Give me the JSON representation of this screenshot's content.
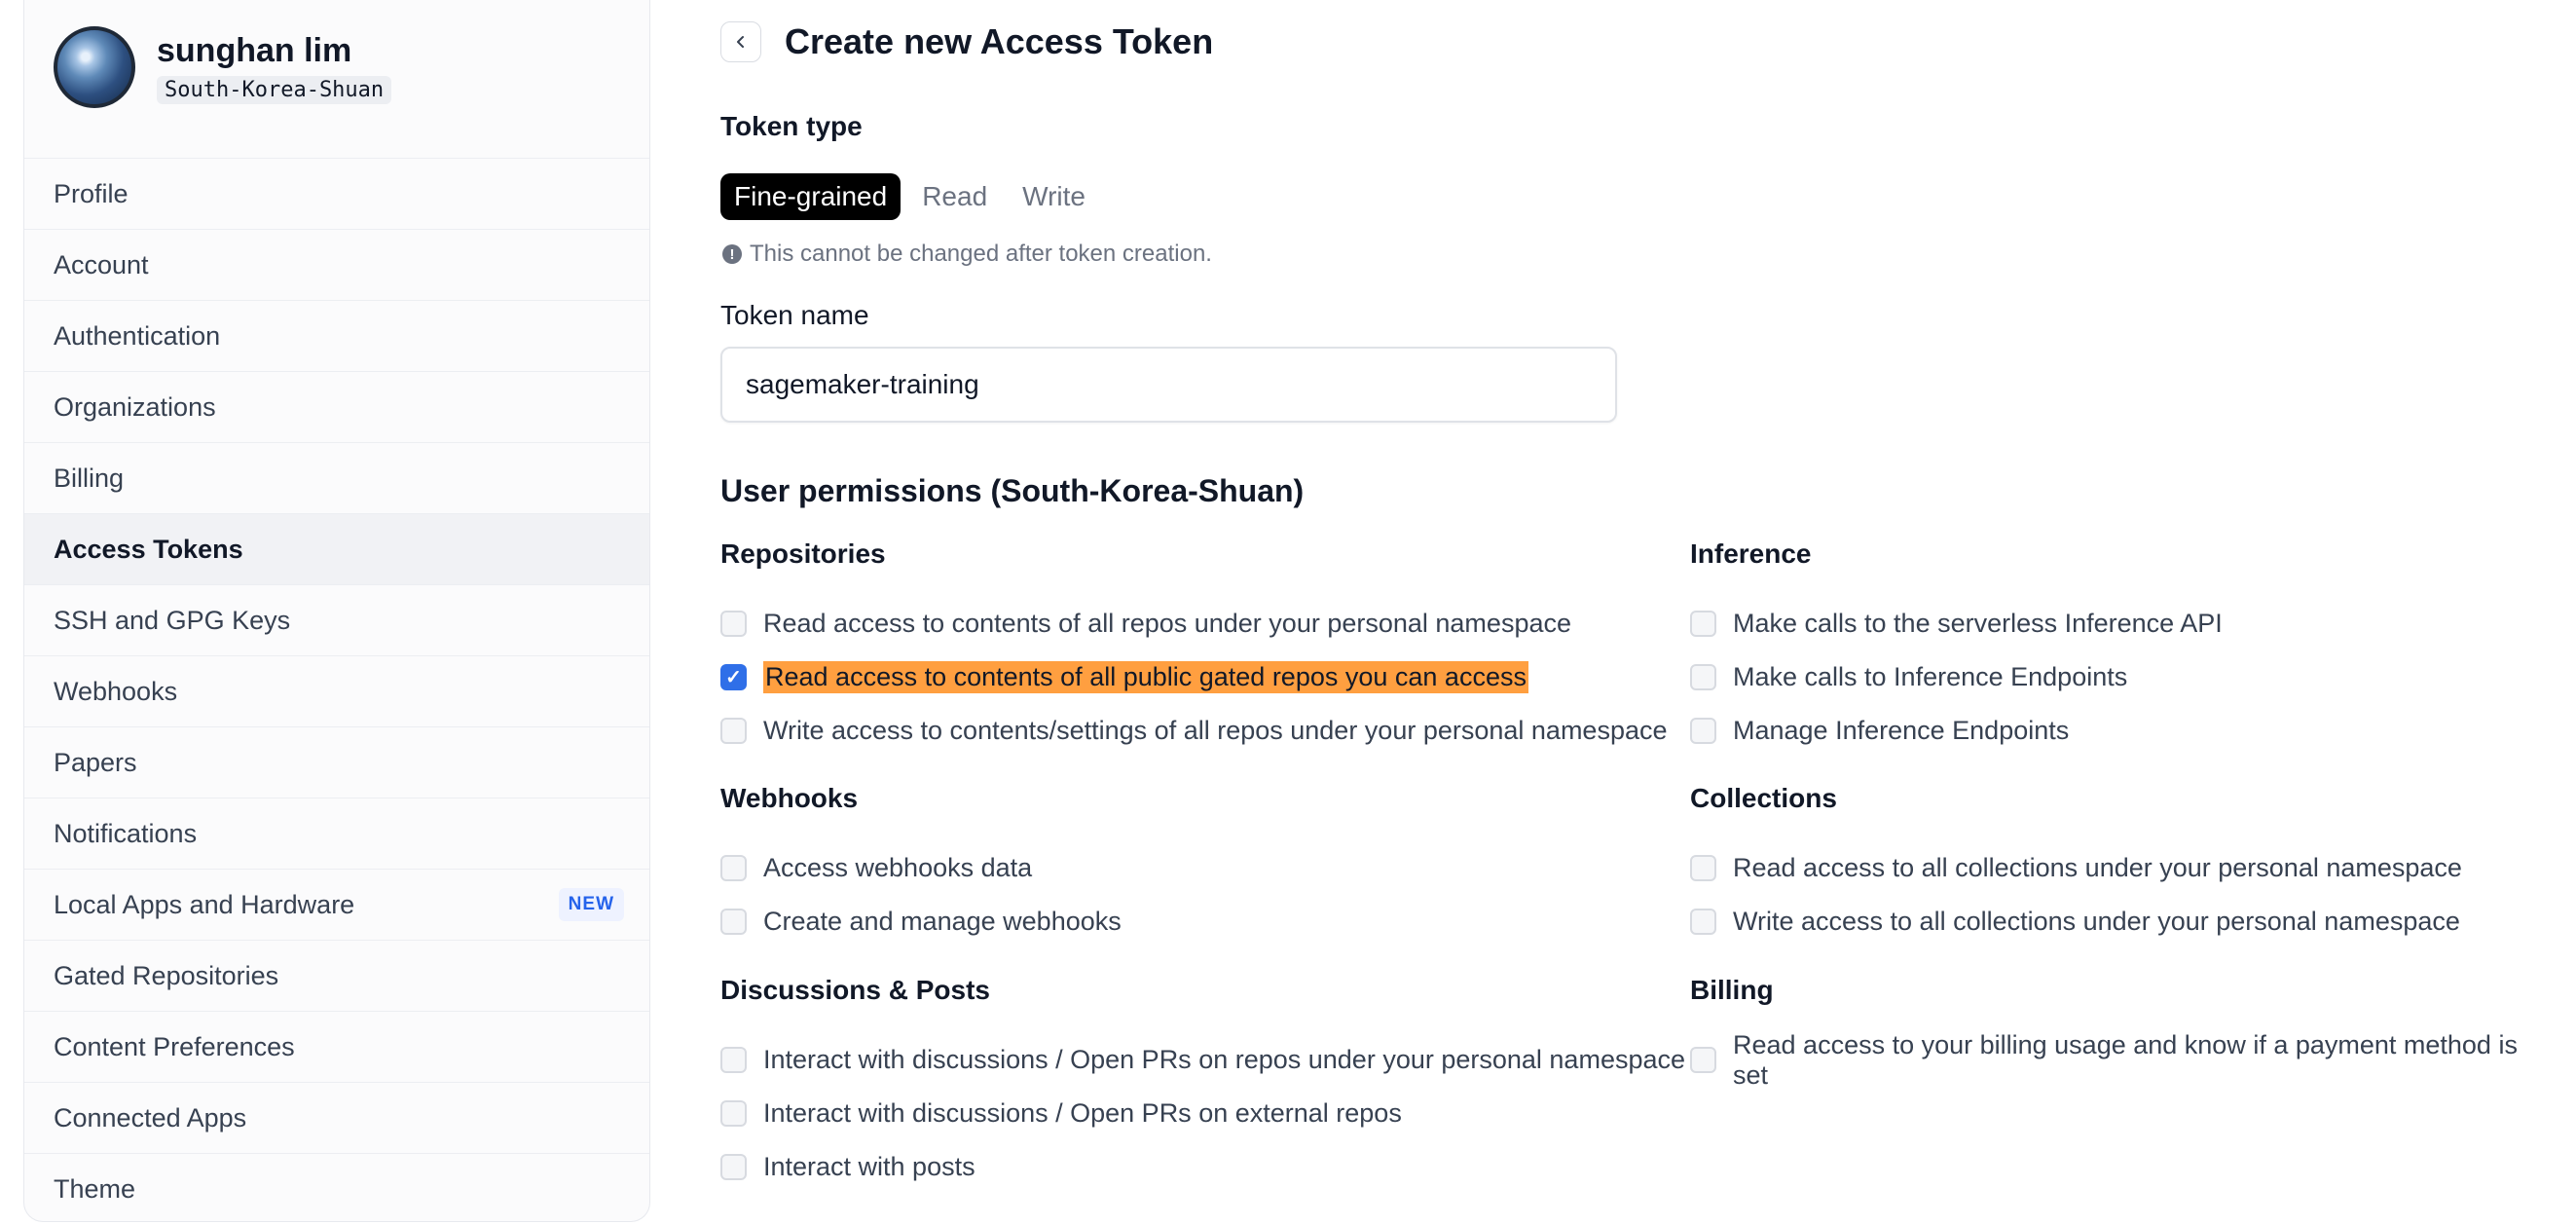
{
  "user": {
    "name": "sunghan lim",
    "handle": "South-Korea-Shuan"
  },
  "sidebar": {
    "items": [
      {
        "label": "Profile"
      },
      {
        "label": "Account"
      },
      {
        "label": "Authentication"
      },
      {
        "label": "Organizations"
      },
      {
        "label": "Billing"
      },
      {
        "label": "Access Tokens",
        "active": true
      },
      {
        "label": "SSH and GPG Keys"
      },
      {
        "label": "Webhooks"
      },
      {
        "label": "Papers"
      },
      {
        "label": "Notifications"
      },
      {
        "label": "Local Apps and Hardware",
        "badge": "NEW"
      },
      {
        "label": "Gated Repositories"
      },
      {
        "label": "Content Preferences"
      },
      {
        "label": "Connected Apps"
      },
      {
        "label": "Theme"
      }
    ]
  },
  "main": {
    "back_icon": "chevron-left-icon",
    "title": "Create new Access Token",
    "token_type_label": "Token type",
    "token_types": [
      "Fine-grained",
      "Read",
      "Write"
    ],
    "token_type_selected": "Fine-grained",
    "hint_icon": "info-icon",
    "hint": "This cannot be changed after token creation.",
    "token_name_label": "Token name",
    "token_name_value": "sagemaker-training",
    "permissions_title": "User permissions (South-Korea-Shuan)",
    "groups": {
      "repositories": {
        "title": "Repositories",
        "options": [
          {
            "label": "Read access to contents of all repos under your personal namespace",
            "checked": false
          },
          {
            "label": "Read access to contents of all public gated repos you can access",
            "checked": true,
            "highlighted": true
          },
          {
            "label": "Write access to contents/settings of all repos under your personal namespace",
            "checked": false
          }
        ]
      },
      "webhooks": {
        "title": "Webhooks",
        "options": [
          {
            "label": "Access webhooks data",
            "checked": false
          },
          {
            "label": "Create and manage webhooks",
            "checked": false
          }
        ]
      },
      "discussions": {
        "title": "Discussions & Posts",
        "options": [
          {
            "label": "Interact with discussions / Open PRs on repos under your personal namespace",
            "checked": false
          },
          {
            "label": "Interact with discussions / Open PRs on external repos",
            "checked": false
          },
          {
            "label": "Interact with posts",
            "checked": false
          }
        ]
      },
      "inference": {
        "title": "Inference",
        "options": [
          {
            "label": "Make calls to the serverless Inference API",
            "checked": false
          },
          {
            "label": "Make calls to Inference Endpoints",
            "checked": false
          },
          {
            "label": "Manage Inference Endpoints",
            "checked": false
          }
        ]
      },
      "collections": {
        "title": "Collections",
        "options": [
          {
            "label": "Read access to all collections under your personal namespace",
            "checked": false
          },
          {
            "label": "Write access to all collections under your personal namespace",
            "checked": false
          }
        ]
      },
      "billing": {
        "title": "Billing",
        "options": [
          {
            "label": "Read access to your billing usage and know if a payment method is set",
            "checked": false
          }
        ]
      }
    }
  },
  "colors": {
    "accent": "#2f6fe8",
    "highlight": "#ff9f40",
    "selected_tab": "#000000"
  }
}
